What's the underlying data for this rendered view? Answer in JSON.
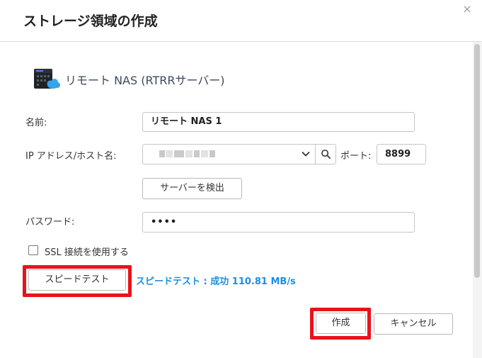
{
  "dialog": {
    "title": "ストレージ領域の作成",
    "close_symbol": "×",
    "device": {
      "label": "リモート NAS (RTRRサーバー)",
      "icon": "nas-cloud-icon"
    }
  },
  "form": {
    "name": {
      "label": "名前:",
      "value": "リモート NAS 1"
    },
    "host": {
      "label": "IP アドレス/ホスト名:"
    },
    "port": {
      "label": "ポート:",
      "value": "8899"
    },
    "detect_button": "サーバーを検出",
    "password": {
      "label": "パスワード:",
      "value": "••••"
    },
    "ssl": {
      "label": "SSL 接続を使用する",
      "checked": false
    },
    "speed_test_button": "スピードテスト",
    "speed_test_result": "スピードテスト : 成功 110.81 MB/s"
  },
  "footer": {
    "create_button": "作成",
    "cancel_button": "キャンセル"
  },
  "colors": {
    "accent": "#1d8fe1",
    "highlight": "#e8131a"
  }
}
